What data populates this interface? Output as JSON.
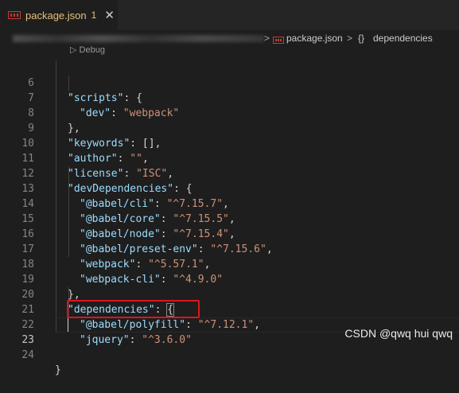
{
  "tab": {
    "title": "package.json",
    "badge": "1",
    "close": "✕",
    "icon": "json-file-icon"
  },
  "breadcrumb": {
    "separator": ">",
    "file": "package.json",
    "symbol_icon": "{}",
    "symbol": "dependencies"
  },
  "codelens": "▷ Debug",
  "lines": [
    {
      "n": "6",
      "text": ""
    },
    {
      "n": "7",
      "text": ""
    },
    {
      "n": "8",
      "text": ""
    },
    {
      "n": "9",
      "text": ""
    },
    {
      "n": "10",
      "text": ""
    },
    {
      "n": "11",
      "text": ""
    },
    {
      "n": "12",
      "text": ""
    },
    {
      "n": "13",
      "text": ""
    },
    {
      "n": "14",
      "text": ""
    },
    {
      "n": "15",
      "text": ""
    },
    {
      "n": "16",
      "text": ""
    },
    {
      "n": "17",
      "text": ""
    },
    {
      "n": "18",
      "text": ""
    },
    {
      "n": "19",
      "text": ""
    },
    {
      "n": "20",
      "text": ""
    },
    {
      "n": "21",
      "text": ""
    },
    {
      "n": "22",
      "text": ""
    },
    {
      "n": "23",
      "text": ""
    },
    {
      "n": "24",
      "text": ""
    }
  ],
  "code": {
    "l6_key": "\"scripts\"",
    "l7_key": "\"dev\"",
    "l7_val": "\"webpack\"",
    "l9_key": "\"keywords\"",
    "l10_key": "\"author\"",
    "l10_val": "\"\"",
    "l11_key": "\"license\"",
    "l11_val": "\"ISC\"",
    "l12_key": "\"devDependencies\"",
    "l13_key": "\"@babel/cli\"",
    "l13_val": "\"^7.15.7\"",
    "l14_key": "\"@babel/core\"",
    "l14_val": "\"^7.15.5\"",
    "l15_key": "\"@babel/node\"",
    "l15_val": "\"^7.15.4\"",
    "l16_key": "\"@babel/preset-env\"",
    "l16_val": "\"^7.15.6\"",
    "l17_key": "\"webpack\"",
    "l17_val": "\"^5.57.1\"",
    "l18_key": "\"webpack-cli\"",
    "l18_val": "\"^4.9.0\"",
    "l20_key": "\"dependencies\"",
    "l21_key": "\"@babel/polyfill\"",
    "l21_val": "\"^7.12.1\"",
    "l22_key": "\"jquery\"",
    "l22_val": "\"^3.6.0\""
  },
  "watermark": "CSDN @qwq hui qwq",
  "colors": {
    "background": "#1e1e1e",
    "key": "#9cdcfe",
    "string": "#ce9178",
    "highlight": "#e0141b",
    "modified_tab": "#e5c07b"
  }
}
